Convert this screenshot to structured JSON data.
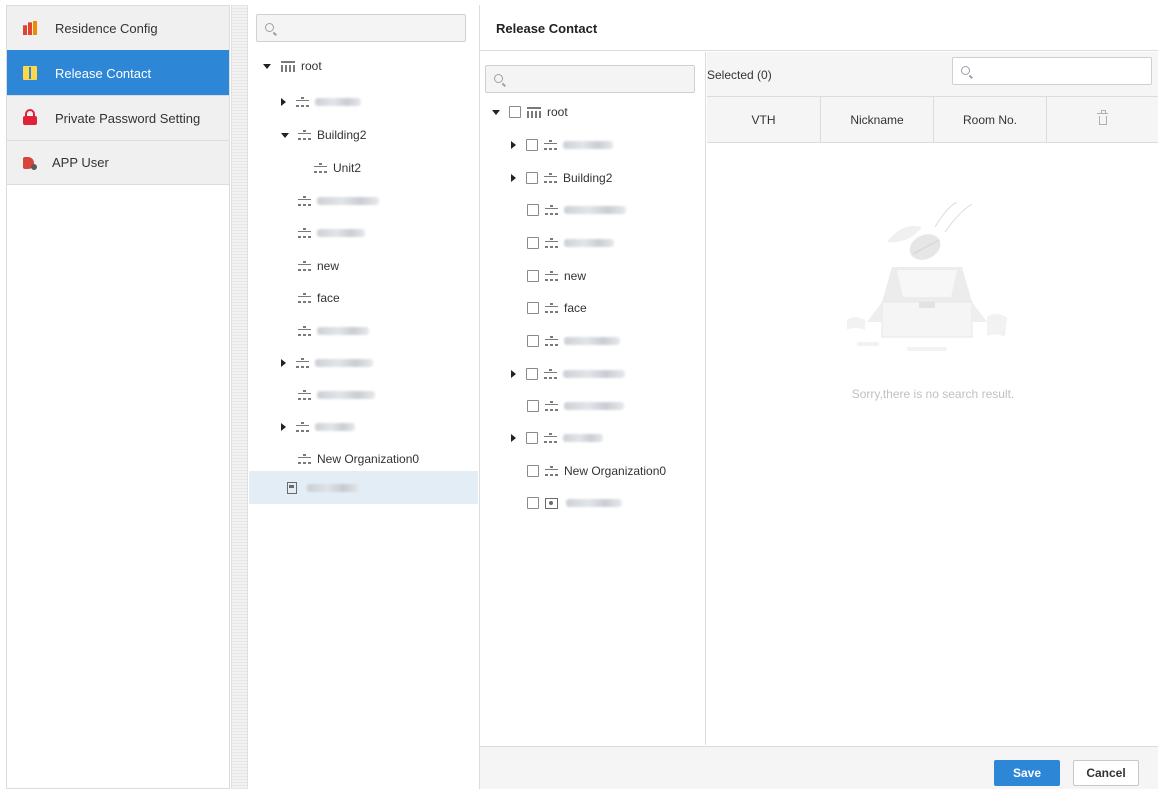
{
  "nav": {
    "items": [
      {
        "label": "Residence Config",
        "icon": "building-icon",
        "active": false
      },
      {
        "label": "Release Contact",
        "icon": "book-icon",
        "active": true
      },
      {
        "label": "Private Password Setting",
        "icon": "lock-icon",
        "active": false
      },
      {
        "label": "APP User",
        "icon": "app-user-icon",
        "active": false
      }
    ]
  },
  "org_tree": {
    "search_placeholder": "",
    "root_label": "root",
    "nodes": [
      {
        "label": "",
        "blurred": true,
        "expandable": true,
        "expanded": false
      },
      {
        "label": "Building2",
        "blurred": false,
        "expandable": true,
        "expanded": true
      },
      {
        "label": "Unit2",
        "blurred": false,
        "expandable": false,
        "child": true
      },
      {
        "label": "",
        "blurred": true,
        "expandable": false
      },
      {
        "label": "",
        "blurred": true,
        "expandable": false
      },
      {
        "label": "new",
        "blurred": false,
        "expandable": false
      },
      {
        "label": "face",
        "blurred": false,
        "expandable": false
      },
      {
        "label": "",
        "blurred": true,
        "expandable": false
      },
      {
        "label": "",
        "blurred": true,
        "expandable": true,
        "expanded": false
      },
      {
        "label": "",
        "blurred": true,
        "expandable": false
      },
      {
        "label": "",
        "blurred": true,
        "expandable": true,
        "expanded": false
      },
      {
        "label": "New Organization0",
        "blurred": false,
        "expandable": false
      },
      {
        "label": "",
        "blurred": true,
        "device": true,
        "selected": true
      }
    ]
  },
  "release_contact": {
    "title": "Release Contact",
    "tree_search_placeholder": "",
    "tree_root_label": "root",
    "tree_nodes": [
      {
        "label": "",
        "blurred": true,
        "expandable": true
      },
      {
        "label": "Building2",
        "blurred": false,
        "expandable": true
      },
      {
        "label": "",
        "blurred": true,
        "expandable": false
      },
      {
        "label": "",
        "blurred": true,
        "expandable": false
      },
      {
        "label": "new",
        "blurred": false,
        "expandable": false
      },
      {
        "label": "face",
        "blurred": false,
        "expandable": false
      },
      {
        "label": "",
        "blurred": true,
        "expandable": false
      },
      {
        "label": "",
        "blurred": true,
        "expandable": true
      },
      {
        "label": "",
        "blurred": true,
        "expandable": false
      },
      {
        "label": "",
        "blurred": true,
        "expandable": true
      },
      {
        "label": "New Organization0",
        "blurred": false,
        "expandable": false
      },
      {
        "label": "",
        "blurred": true,
        "card": true
      }
    ],
    "selected_label": "Selected (0)",
    "selected_search_placeholder": "",
    "columns": [
      "VTH",
      "Nickname",
      "Room No."
    ],
    "empty_message": "Sorry,there is no search result.",
    "save_label": "Save",
    "cancel_label": "Cancel"
  },
  "colors": {
    "accent": "#2d86d6",
    "panel_bg": "#f5f5f5",
    "border": "#dcdcdc"
  }
}
